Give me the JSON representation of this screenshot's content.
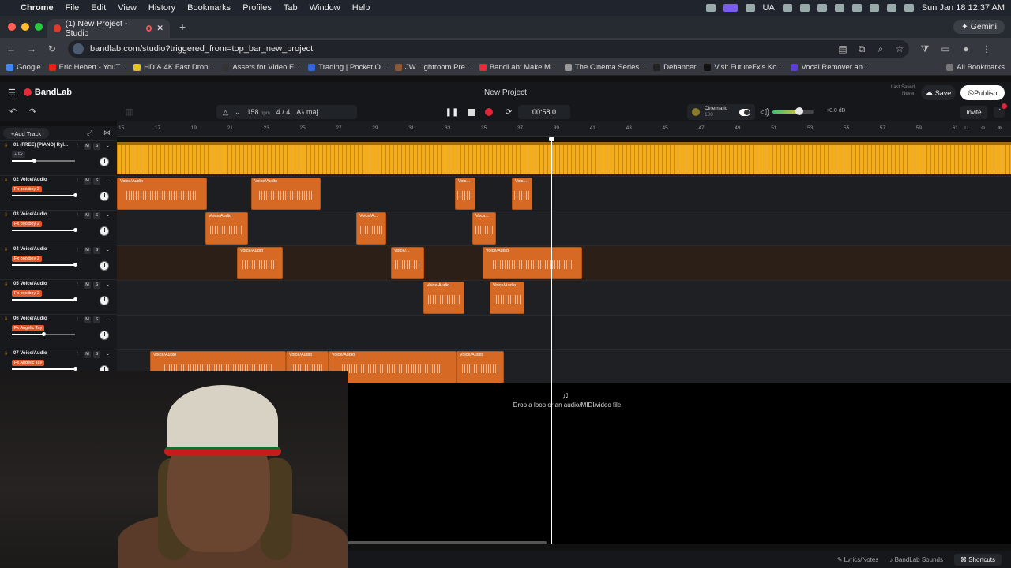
{
  "menubar": {
    "app": "Chrome",
    "items": [
      "File",
      "Edit",
      "View",
      "History",
      "Bookmarks",
      "Profiles",
      "Tab",
      "Window",
      "Help"
    ],
    "lang": "UA",
    "datetime": "Sun Jan 18  12:37 AM"
  },
  "tab": {
    "title": "(1) New Project - Studio",
    "new_tab": "+"
  },
  "gemini_label": "Gemini",
  "address": {
    "url": "bandlab.com/studio?triggered_from=top_bar_new_project"
  },
  "bookmarks": {
    "items": [
      "Google",
      "Eric Hebert - YouT...",
      "HD & 4K Fast Dron...",
      "Assets for Video E...",
      "Trading | Pocket O...",
      "JW Lightroom Pre...",
      "BandLab: Make M...",
      "The Cinema Series...",
      "Dehancer",
      "Visit FutureFx's Ko...",
      "Vocal Remover an..."
    ],
    "all": "All Bookmarks"
  },
  "bandlab": {
    "logo": "BandLab",
    "project_title": "New Project",
    "last_saved_label": "Last Saved",
    "last_saved_value": "Never",
    "save": "Save",
    "publish": "Publish",
    "invite": "Invite"
  },
  "transport": {
    "bpm": "158",
    "bpm_unit": "bpm",
    "time_sig": "4 / 4",
    "key": "A♭ maj",
    "time": "00:58.0",
    "preset_name": "Cinematic",
    "preset_value": "100",
    "master_db": "+0.0 dB",
    "master_level": 0.55
  },
  "panel": {
    "add_track": "Add Track"
  },
  "ruler": [
    "15",
    "17",
    "19",
    "21",
    "23",
    "25",
    "27",
    "29",
    "31",
    "33",
    "35",
    "37",
    "39",
    "41",
    "43",
    "45",
    "47",
    "49",
    "51",
    "53",
    "55",
    "57",
    "59",
    "61"
  ],
  "tracks": [
    {
      "name": "01  (FREE) [PIANO] Ryl...",
      "fx": "+ Fx",
      "fx_plain": true,
      "volume": 0.5,
      "mute": "M",
      "solo": "S"
    },
    {
      "name": "02  Voice/Audio",
      "fx": "Fx  pootboy 2",
      "fx_plain": false,
      "volume": 1.0,
      "mute": "M",
      "solo": "S"
    },
    {
      "name": "03  Voice/Audio",
      "fx": "Fx  pootboy 2",
      "fx_plain": false,
      "volume": 1.0,
      "mute": "M",
      "solo": "S"
    },
    {
      "name": "04  Voice/Audio",
      "fx": "Fx  pootboy 2",
      "fx_plain": false,
      "volume": 1.0,
      "mute": "M",
      "solo": "S"
    },
    {
      "name": "05  Voice/Audio",
      "fx": "Fx  pootboy 2",
      "fx_plain": false,
      "volume": 1.0,
      "mute": "M",
      "solo": "S"
    },
    {
      "name": "06  Voice/Audio",
      "fx": "Fx  Angelic Tay",
      "fx_plain": false,
      "volume": 0.8,
      "mute": "M",
      "solo": "S"
    },
    {
      "name": "07  Voice/Audio",
      "fx": "Fx  Angelic Tay",
      "fx_plain": false,
      "volume": 1.0,
      "mute": "M",
      "solo": "S"
    }
  ],
  "clip_labels": {
    "voice_audio": "Voice/Audio",
    "voc": "Voic...",
    "voc2": "Voic...",
    "voice_a": "Voice/A...",
    "voice_dots": "Voice/...",
    "voca": "Voca..."
  },
  "dropzone": {
    "text": "Drop a loop or an audio/MIDI/video file"
  },
  "bottom": {
    "lyrics": "Lyrics/Notes",
    "sounds": "BandLab Sounds",
    "shortcuts": "Shortcuts"
  },
  "colors": {
    "accent": "#f4ad1d",
    "clip": "#d66a24",
    "record": "#e0243a"
  }
}
